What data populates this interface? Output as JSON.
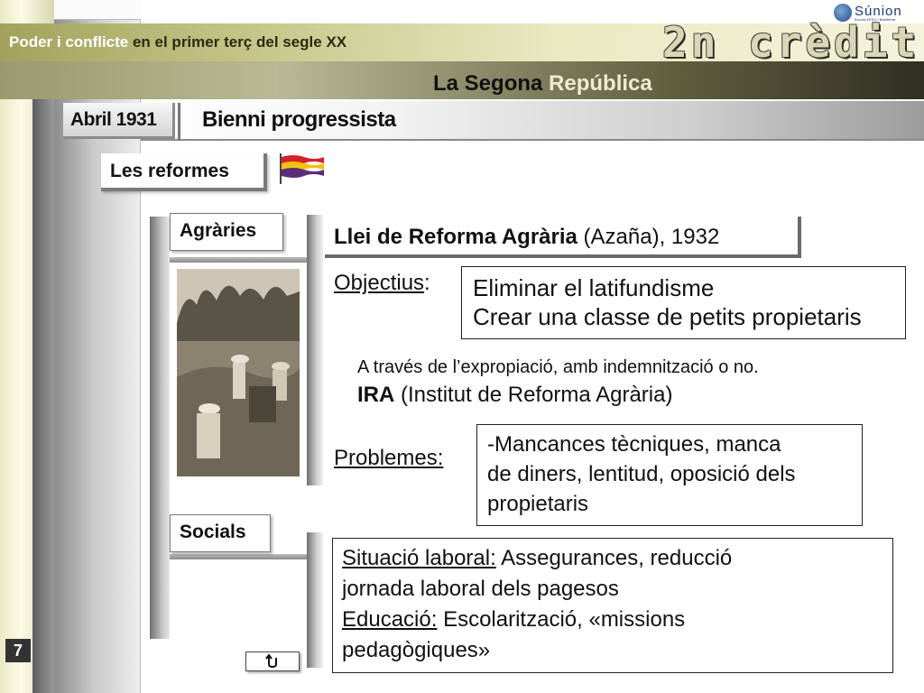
{
  "header": {
    "course_title_white": "Poder i conflicte",
    "course_title_dark": " en el primer terç del segle XX",
    "credit_label": "2n crèdit",
    "logo_text": "Súnion",
    "logo_subtext": "Escola d'ESO i Batxillerat",
    "section_title_dark": "La Segona ",
    "section_title_light": "República"
  },
  "period": {
    "date_tab": "Abril 1931",
    "period_title": "Bienni progressista"
  },
  "reforms": {
    "title": "Les reformes",
    "agrarian_label": "Agràries",
    "social_label": "Socials"
  },
  "agrarian_law": {
    "law_name": "Llei de Reforma Agrària",
    "law_suffix": " (Azaña), 1932",
    "objectives_label": "Objectius",
    "objectives_colon": ":",
    "objective_1": "Eliminar el latifundisme",
    "objective_2": "Crear una classe de petits propietaris",
    "means": "A través  de l’expropiació, amb indemnització o no.",
    "ira_abbrev": "IRA",
    "ira_full": " (Institut de Reforma Agrària)",
    "problems_label": "Problemes:",
    "problems_lines": [
      "-Mancances  tècniques,  manca",
      "de diners, lentitud, oposició dels",
      "propietaris"
    ]
  },
  "social": {
    "labor_label": "Situació laboral:",
    "labor_text_1": " Assegurances, reducció",
    "labor_text_2": "jornada laboral dels pagesos",
    "education_label": "Educació:",
    "education_text_1": " Escolarització, «missions",
    "education_text_2": "pedagògiques»"
  },
  "footer": {
    "page_number": "7",
    "return_icon": "return-arrow-icon"
  },
  "colors": {
    "band_olive": "#a2a25c",
    "band_dark": "#2f2f22",
    "logo_blue": "#244d86"
  }
}
